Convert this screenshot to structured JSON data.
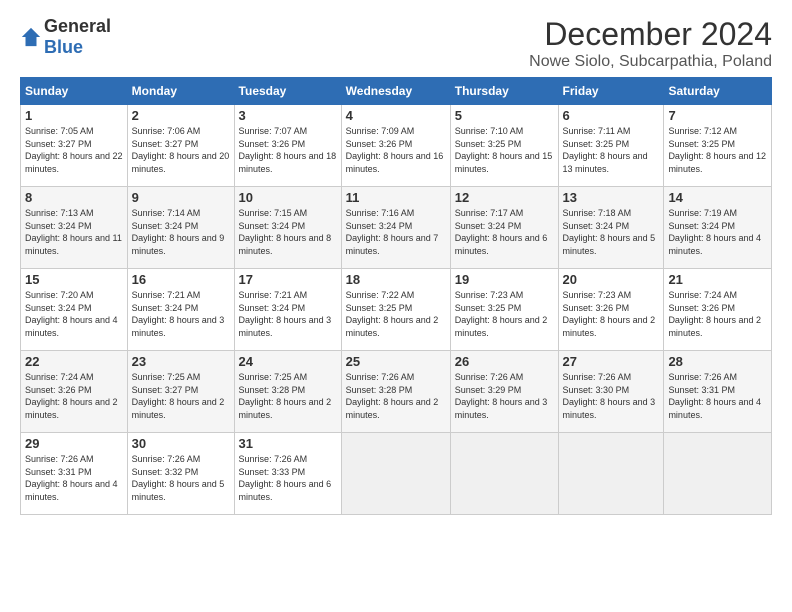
{
  "logo": {
    "general": "General",
    "blue": "Blue"
  },
  "title": "December 2024",
  "subtitle": "Nowe Siolo, Subcarpathia, Poland",
  "headers": [
    "Sunday",
    "Monday",
    "Tuesday",
    "Wednesday",
    "Thursday",
    "Friday",
    "Saturday"
  ],
  "weeks": [
    [
      {
        "day": "1",
        "sunrise": "7:05 AM",
        "sunset": "3:27 PM",
        "daylight": "8 hours and 22 minutes."
      },
      {
        "day": "2",
        "sunrise": "7:06 AM",
        "sunset": "3:27 PM",
        "daylight": "8 hours and 20 minutes."
      },
      {
        "day": "3",
        "sunrise": "7:07 AM",
        "sunset": "3:26 PM",
        "daylight": "8 hours and 18 minutes."
      },
      {
        "day": "4",
        "sunrise": "7:09 AM",
        "sunset": "3:26 PM",
        "daylight": "8 hours and 16 minutes."
      },
      {
        "day": "5",
        "sunrise": "7:10 AM",
        "sunset": "3:25 PM",
        "daylight": "8 hours and 15 minutes."
      },
      {
        "day": "6",
        "sunrise": "7:11 AM",
        "sunset": "3:25 PM",
        "daylight": "8 hours and 13 minutes."
      },
      {
        "day": "7",
        "sunrise": "7:12 AM",
        "sunset": "3:25 PM",
        "daylight": "8 hours and 12 minutes."
      }
    ],
    [
      {
        "day": "8",
        "sunrise": "7:13 AM",
        "sunset": "3:24 PM",
        "daylight": "8 hours and 11 minutes."
      },
      {
        "day": "9",
        "sunrise": "7:14 AM",
        "sunset": "3:24 PM",
        "daylight": "8 hours and 9 minutes."
      },
      {
        "day": "10",
        "sunrise": "7:15 AM",
        "sunset": "3:24 PM",
        "daylight": "8 hours and 8 minutes."
      },
      {
        "day": "11",
        "sunrise": "7:16 AM",
        "sunset": "3:24 PM",
        "daylight": "8 hours and 7 minutes."
      },
      {
        "day": "12",
        "sunrise": "7:17 AM",
        "sunset": "3:24 PM",
        "daylight": "8 hours and 6 minutes."
      },
      {
        "day": "13",
        "sunrise": "7:18 AM",
        "sunset": "3:24 PM",
        "daylight": "8 hours and 5 minutes."
      },
      {
        "day": "14",
        "sunrise": "7:19 AM",
        "sunset": "3:24 PM",
        "daylight": "8 hours and 4 minutes."
      }
    ],
    [
      {
        "day": "15",
        "sunrise": "7:20 AM",
        "sunset": "3:24 PM",
        "daylight": "8 hours and 4 minutes."
      },
      {
        "day": "16",
        "sunrise": "7:21 AM",
        "sunset": "3:24 PM",
        "daylight": "8 hours and 3 minutes."
      },
      {
        "day": "17",
        "sunrise": "7:21 AM",
        "sunset": "3:24 PM",
        "daylight": "8 hours and 3 minutes."
      },
      {
        "day": "18",
        "sunrise": "7:22 AM",
        "sunset": "3:25 PM",
        "daylight": "8 hours and 2 minutes."
      },
      {
        "day": "19",
        "sunrise": "7:23 AM",
        "sunset": "3:25 PM",
        "daylight": "8 hours and 2 minutes."
      },
      {
        "day": "20",
        "sunrise": "7:23 AM",
        "sunset": "3:26 PM",
        "daylight": "8 hours and 2 minutes."
      },
      {
        "day": "21",
        "sunrise": "7:24 AM",
        "sunset": "3:26 PM",
        "daylight": "8 hours and 2 minutes."
      }
    ],
    [
      {
        "day": "22",
        "sunrise": "7:24 AM",
        "sunset": "3:26 PM",
        "daylight": "8 hours and 2 minutes."
      },
      {
        "day": "23",
        "sunrise": "7:25 AM",
        "sunset": "3:27 PM",
        "daylight": "8 hours and 2 minutes."
      },
      {
        "day": "24",
        "sunrise": "7:25 AM",
        "sunset": "3:28 PM",
        "daylight": "8 hours and 2 minutes."
      },
      {
        "day": "25",
        "sunrise": "7:26 AM",
        "sunset": "3:28 PM",
        "daylight": "8 hours and 2 minutes."
      },
      {
        "day": "26",
        "sunrise": "7:26 AM",
        "sunset": "3:29 PM",
        "daylight": "8 hours and 3 minutes."
      },
      {
        "day": "27",
        "sunrise": "7:26 AM",
        "sunset": "3:30 PM",
        "daylight": "8 hours and 3 minutes."
      },
      {
        "day": "28",
        "sunrise": "7:26 AM",
        "sunset": "3:31 PM",
        "daylight": "8 hours and 4 minutes."
      }
    ],
    [
      {
        "day": "29",
        "sunrise": "7:26 AM",
        "sunset": "3:31 PM",
        "daylight": "8 hours and 4 minutes."
      },
      {
        "day": "30",
        "sunrise": "7:26 AM",
        "sunset": "3:32 PM",
        "daylight": "8 hours and 5 minutes."
      },
      {
        "day": "31",
        "sunrise": "7:26 AM",
        "sunset": "3:33 PM",
        "daylight": "8 hours and 6 minutes."
      },
      null,
      null,
      null,
      null
    ]
  ],
  "labels": {
    "sunrise": "Sunrise:",
    "sunset": "Sunset:",
    "daylight": "Daylight:"
  }
}
